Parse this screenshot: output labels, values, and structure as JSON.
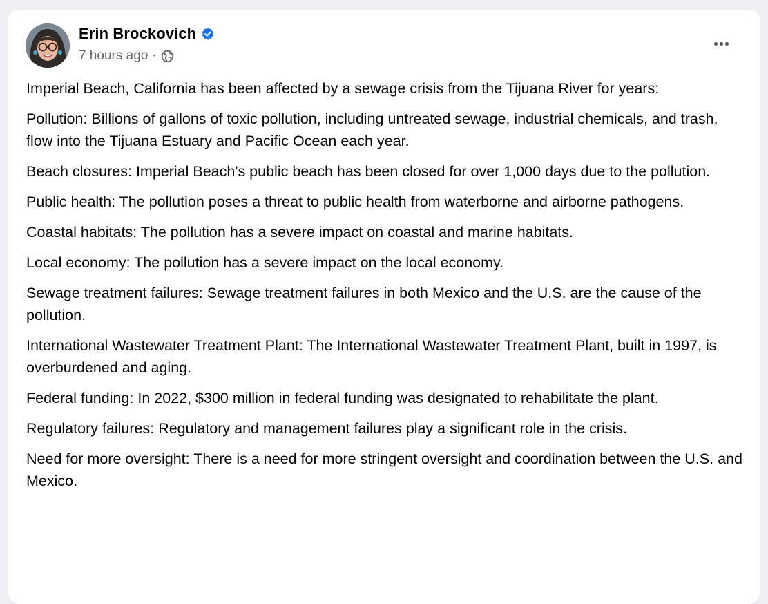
{
  "post": {
    "author": "Erin Brockovich",
    "timestamp": "7 hours ago",
    "separator": "·",
    "verified_icon": "verified-badge-icon",
    "audience_icon": "globe-icon",
    "more_icon": "more-options-icon",
    "paragraphs": [
      "Imperial Beach, California has been affected by a sewage crisis from the Tijuana River for years:",
      "Pollution: Billions of gallons of toxic pollution, including untreated sewage, industrial chemicals, and trash, flow into the Tijuana Estuary and Pacific Ocean each year.",
      "Beach closures: Imperial Beach's public beach has been closed for over 1,000 days due to the pollution.",
      "Public health: The pollution poses a threat to public health from waterborne and airborne pathogens.",
      "Coastal habitats: The pollution has a severe impact on coastal and marine habitats.",
      "Local economy: The pollution has a severe impact on the local economy.",
      "Sewage treatment failures: Sewage treatment failures in both Mexico and the U.S. are the cause of the pollution.",
      "International Wastewater Treatment Plant: The International Wastewater Treatment Plant, built in 1997, is overburdened and aging.",
      "Federal funding: In 2022, $300 million in federal funding was designated to rehabilitate the plant.",
      "Regulatory failures: Regulatory and management failures play a significant role in the crisis.",
      "Need for more oversight: There is a need for more stringent oversight and coordination between the U.S. and Mexico."
    ]
  },
  "colors": {
    "accent": "#1b74e4",
    "secondary_text": "#65676b",
    "background": "#eef0f3"
  }
}
